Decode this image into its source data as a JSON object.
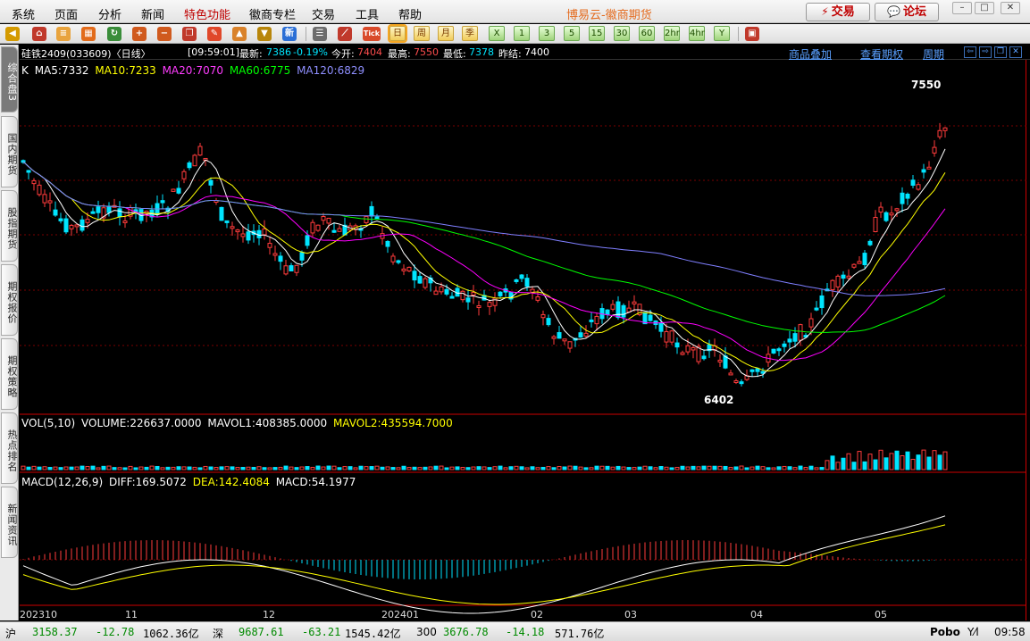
{
  "menu": [
    "系统",
    "页面",
    "分析",
    "新闻",
    "特色功能",
    "徽商专栏",
    "交易",
    "工具",
    "帮助"
  ],
  "app_title": "博易云-徽商期货",
  "buttons": {
    "trade": "交易",
    "forum": "论坛"
  },
  "toolbar": {
    "periods": [
      "日",
      "周",
      "月",
      "季",
      "X",
      "1",
      "3",
      "5",
      "15",
      "30",
      "60",
      "2hr",
      "4hr",
      "Y"
    ],
    "active_period": "日",
    "tick_label": "Tick"
  },
  "side_tabs": [
    "综合盘3",
    "国内期货",
    "股指期货",
    "期权报价",
    "期权策略",
    "热点排名",
    "新闻资讯"
  ],
  "info": {
    "symbol": "硅铁2409(033609)〈日线〉",
    "time": "[09:59:01]",
    "latest_label": "最新:",
    "latest": "7386",
    "change": "-0.19%",
    "open_label": "今开:",
    "open": "7404",
    "high_label": "最高:",
    "high": "7550",
    "low_label": "最低:",
    "low": "7378",
    "prev_label": "昨结:",
    "prev": "7400",
    "links": [
      "商品叠加",
      "查看期权",
      "周期"
    ]
  },
  "legends": {
    "k": "K",
    "ma5": "MA5:7332",
    "ma10": "MA10:7233",
    "ma20": "MA20:7070",
    "ma60": "MA60:6775",
    "ma120": "MA120:6829",
    "vol": "VOL(5,10)",
    "volume": "VOLUME:226637.0000",
    "mavol1": "MAVOL1:408385.0000",
    "mavol2": "MAVOL2:435594.7000",
    "macd": "MACD(12,26,9)",
    "diff": "DIFF:169.5072",
    "dea": "DEA:142.4084",
    "macd_val": "MACD:54.1977"
  },
  "annotations": {
    "high": "7550",
    "low": "6402"
  },
  "x_labels": [
    "202310",
    "11",
    "12",
    "202401",
    "02",
    "03",
    "04",
    "05"
  ],
  "colors": {
    "up": "#ff3b3b",
    "down": "#00e5ff",
    "ma5": "#ffffff",
    "ma10": "#ffff00",
    "ma20": "#ff00ff",
    "ma60": "#00ff00",
    "ma120": "#7f7fff",
    "grid": "#7a0000"
  },
  "status": {
    "sh_label": "沪",
    "sh": "3158.37",
    "sh_chg": "-12.78",
    "sh_amt": "1062.36亿",
    "sz_label": "深",
    "sz": "9687.61",
    "sz_chg": "-63.21",
    "sz_amt": "1545.42亿",
    "idx_label": "300",
    "idx": "3676.78",
    "idx_chg": "-14.18",
    "idx_amt": "571.76亿",
    "brand": "Pobo",
    "clock": "09:58"
  }
}
